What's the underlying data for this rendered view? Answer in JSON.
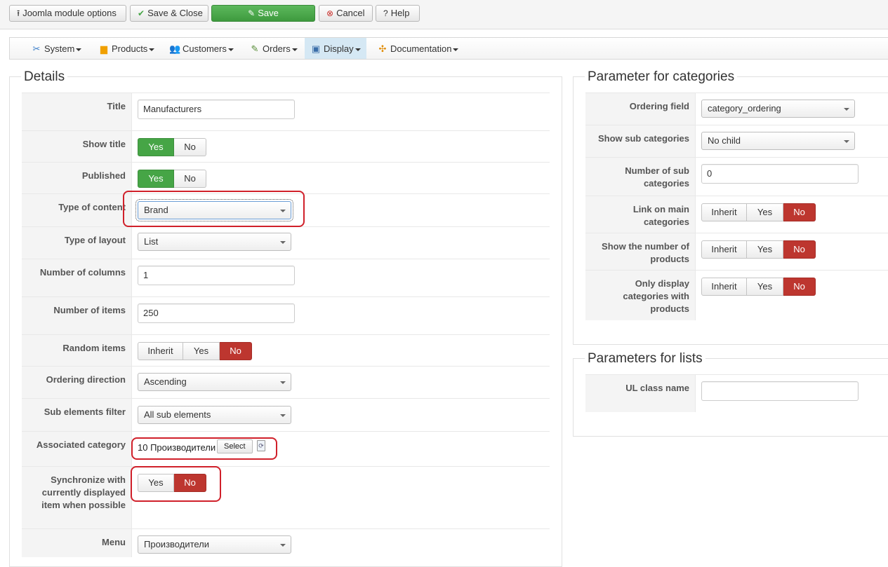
{
  "toolbar": {
    "module_options": "Joomla module options",
    "save_close": "Save & Close",
    "save": "Save",
    "cancel": "Cancel",
    "help": "Help"
  },
  "menu": {
    "system": "System",
    "products": "Products",
    "customers": "Customers",
    "orders": "Orders",
    "display": "Display",
    "documentation": "Documentation"
  },
  "details": {
    "legend": "Details",
    "title_label": "Title",
    "title_value": "Manufacturers",
    "show_title_label": "Show title",
    "published_label": "Published",
    "type_content_label": "Type of content",
    "type_content_value": "Brand",
    "type_layout_label": "Type of layout",
    "type_layout_value": "List",
    "num_columns_label": "Number of columns",
    "num_columns_value": "1",
    "num_items_label": "Number of items",
    "num_items_value": "250",
    "random_items_label": "Random items",
    "ordering_direction_label": "Ordering direction",
    "ordering_direction_value": "Ascending",
    "sub_filter_label": "Sub elements filter",
    "sub_filter_value": "All sub elements",
    "assoc_category_label": "Associated category",
    "assoc_category_value": "10 Производители",
    "select_button": "Select",
    "sync_label": "Synchronize with currently displayed item when possible",
    "menu_label": "Menu",
    "menu_value": "Производители"
  },
  "buttons": {
    "yes": "Yes",
    "no": "No",
    "inherit": "Inherit"
  },
  "categories": {
    "legend": "Parameter for categories",
    "ordering_field_label": "Ordering field",
    "ordering_field_value": "category_ordering",
    "show_sub_label": "Show sub categories",
    "show_sub_value": "No child",
    "num_sub_label": "Number of sub categories",
    "num_sub_value": "0",
    "link_main_label": "Link on main categories",
    "show_number_label": "Show the number of products",
    "only_display_label": "Only display categories with products"
  },
  "lists": {
    "legend": "Parameters for lists",
    "ul_class_label": "UL class name",
    "ul_class_value": ""
  },
  "colors": {
    "green": "#46a546",
    "red": "#bd362f",
    "highlight": "#d0202a",
    "active_menu": "#d5e8f4"
  }
}
